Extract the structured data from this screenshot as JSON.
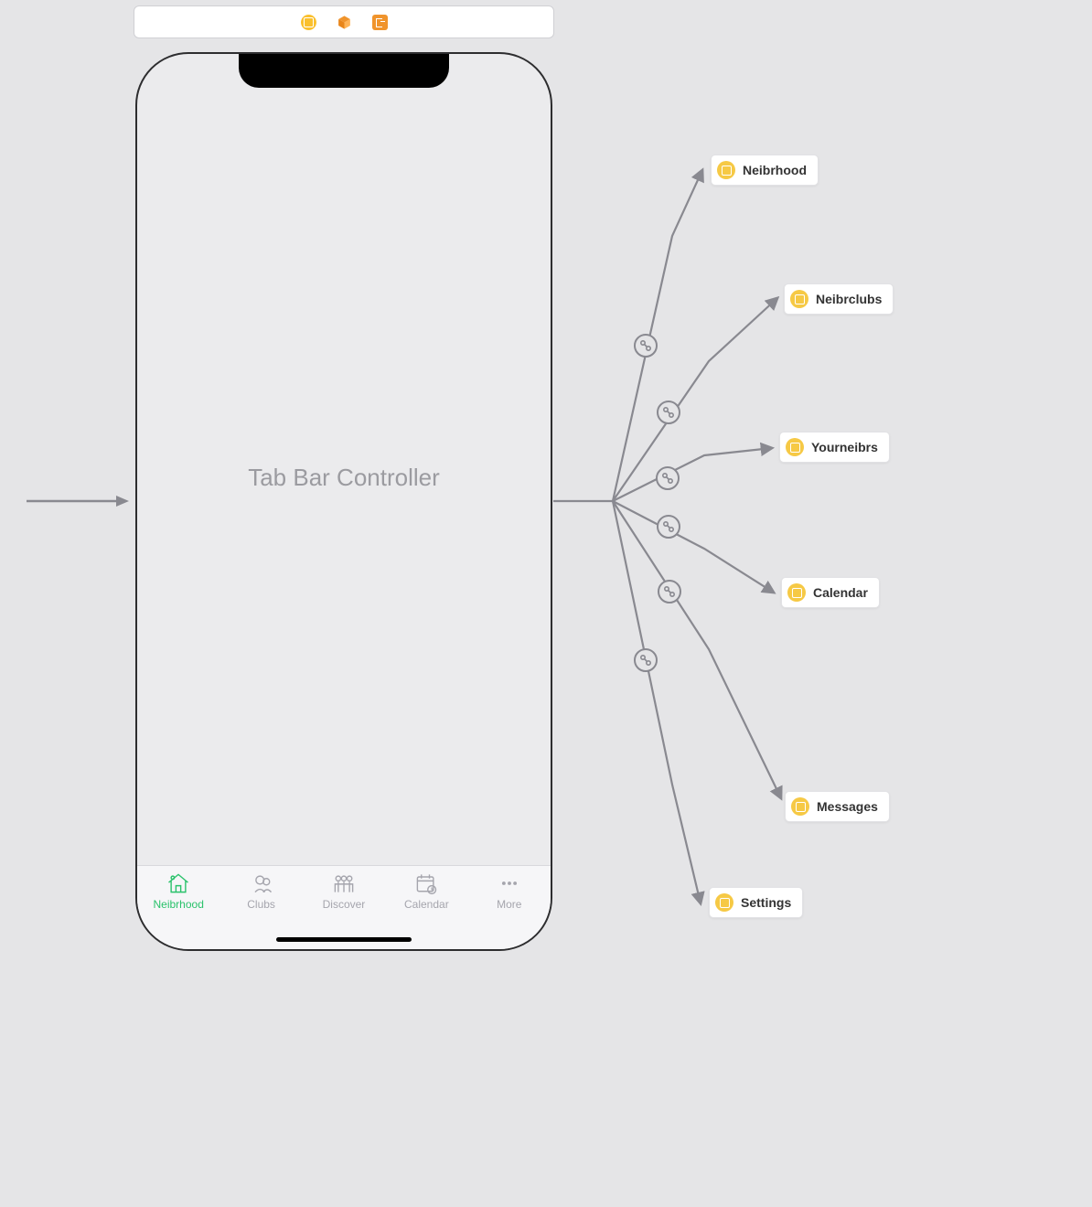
{
  "toolbar": {
    "icons": [
      "scene-icon",
      "cube-icon",
      "exit-icon"
    ]
  },
  "scene": {
    "title": "Tab Bar Controller"
  },
  "tabbar": {
    "items": [
      {
        "label": "Neibrhood",
        "icon": "house-icon",
        "active": true
      },
      {
        "label": "Clubs",
        "icon": "clubs-icon",
        "active": false
      },
      {
        "label": "Discover",
        "icon": "discover-icon",
        "active": false
      },
      {
        "label": "Calendar",
        "icon": "calendar-icon",
        "active": false
      },
      {
        "label": "More",
        "icon": "more-icon",
        "active": false
      }
    ]
  },
  "destinations": [
    {
      "label": "Neibrhood"
    },
    {
      "label": "Neibrclubs"
    },
    {
      "label": "Yourneibrs"
    },
    {
      "label": "Calendar"
    },
    {
      "label": "Messages"
    },
    {
      "label": "Settings"
    }
  ]
}
